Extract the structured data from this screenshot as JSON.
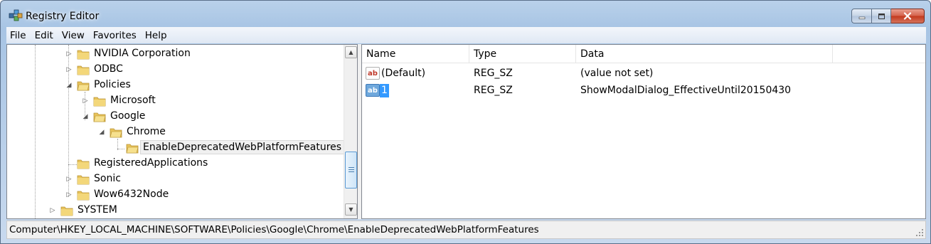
{
  "window": {
    "title": "Registry Editor",
    "app_icon": "registry-editor-icon"
  },
  "menu": {
    "items": [
      "File",
      "Edit",
      "View",
      "Favorites",
      "Help"
    ]
  },
  "tree": {
    "items": [
      {
        "label": "NVIDIA Corporation",
        "expander": "collapsed"
      },
      {
        "label": "ODBC",
        "expander": "collapsed"
      },
      {
        "label": "Policies",
        "expander": "expanded"
      },
      {
        "label": "Microsoft",
        "expander": "collapsed"
      },
      {
        "label": "Google",
        "expander": "expanded"
      },
      {
        "label": "Chrome",
        "expander": "expanded"
      },
      {
        "label": "EnableDeprecatedWebPlatformFeatures",
        "expander": "none",
        "selected": true
      },
      {
        "label": "RegisteredApplications",
        "expander": "none"
      },
      {
        "label": "Sonic",
        "expander": "collapsed"
      },
      {
        "label": "Wow6432Node",
        "expander": "collapsed"
      },
      {
        "label": "SYSTEM",
        "expander": "collapsed"
      }
    ]
  },
  "list": {
    "columns": [
      "Name",
      "Type",
      "Data"
    ],
    "rows": [
      {
        "name": "(Default)",
        "type": "REG_SZ",
        "data": "(value not set)",
        "icon": "string-value-icon",
        "editing": false
      },
      {
        "name": "1",
        "type": "REG_SZ",
        "data": "ShowModalDialog_EffectiveUntil20150430",
        "icon": "string-value-icon",
        "editing": true
      }
    ]
  },
  "status": {
    "path": "Computer\\HKEY_LOCAL_MACHINE\\SOFTWARE\\Policies\\Google\\Chrome\\EnableDeprecatedWebPlatformFeatures"
  },
  "colors": {
    "folder": "#e8c35a",
    "selection_edit": "#3399ff",
    "close_button": "#c3381c"
  }
}
